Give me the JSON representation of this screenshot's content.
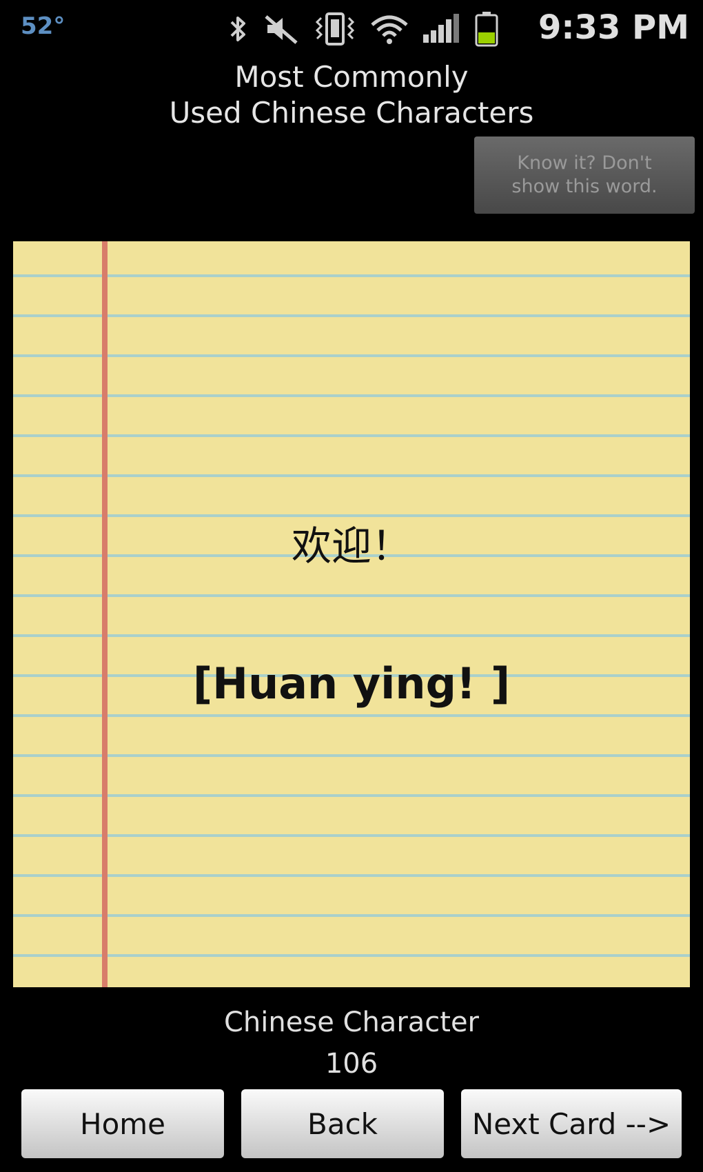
{
  "status_bar": {
    "temperature": "52°",
    "time": "9:33 PM",
    "icons": [
      "bluetooth-icon",
      "mute-icon",
      "vibrate-icon",
      "wifi-icon",
      "signal-icon",
      "battery-icon"
    ]
  },
  "title": {
    "line1": "Most Commonly",
    "line2": "Used Chinese Characters"
  },
  "know_button": {
    "label": "Know it? Don't show this word."
  },
  "card": {
    "character": "欢迎！",
    "pinyin": "[Huan ying!   ]"
  },
  "footer": {
    "label": "Chinese Character",
    "number": "106"
  },
  "buttons": {
    "home": "Home",
    "back": "Back",
    "next": "Next Card -->"
  },
  "colors": {
    "background": "#000000",
    "paper": "#f1e39a",
    "rule_line": "#a9d0cb",
    "margin_line": "#d87d6a",
    "temperature": "#5d8fc2",
    "battery": "#9bd000"
  }
}
